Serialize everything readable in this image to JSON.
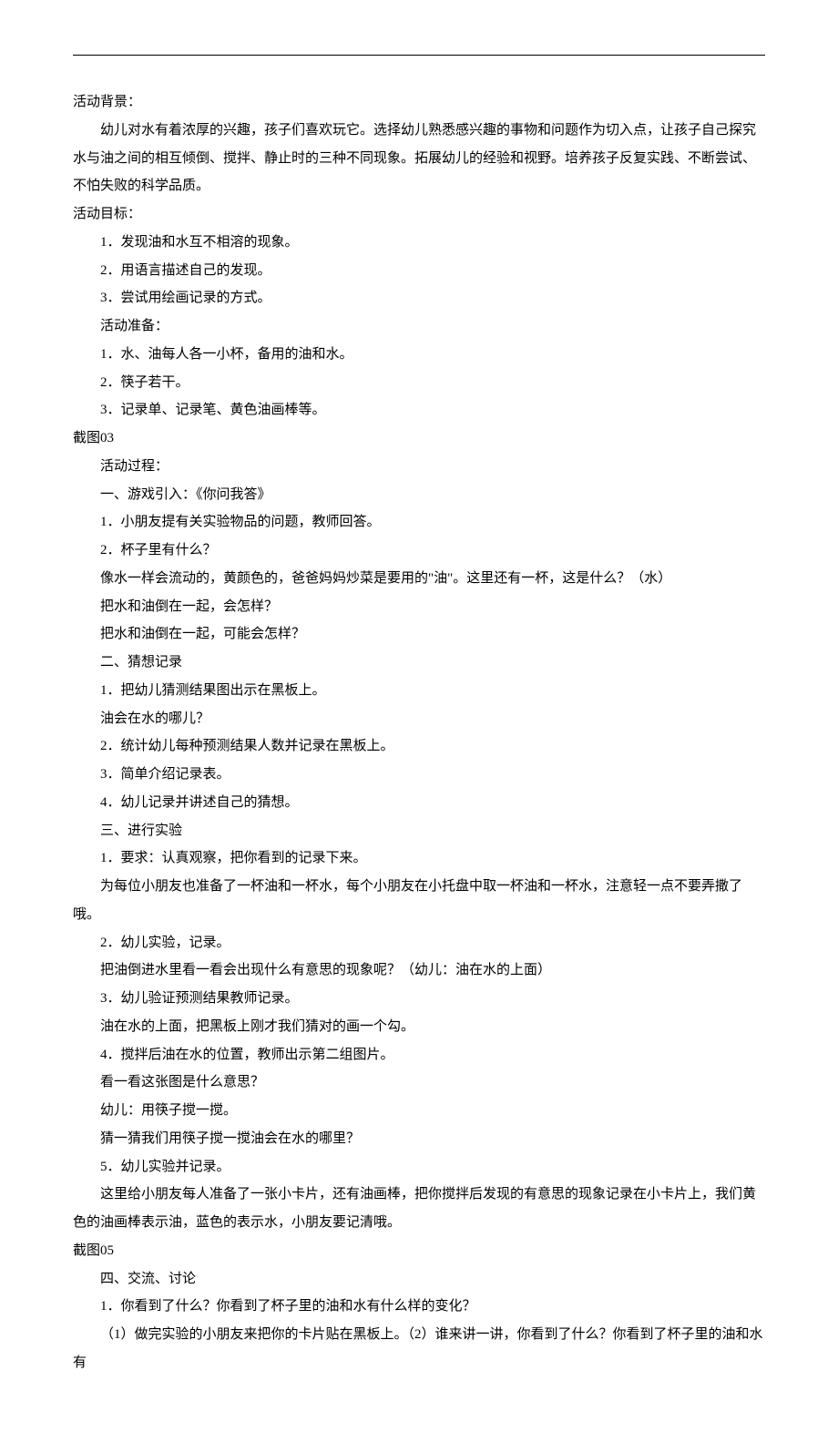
{
  "lines": [
    {
      "cls": "noindent",
      "text": "活动背景："
    },
    {
      "cls": "indent1",
      "text": "幼儿对水有着浓厚的兴趣，孩子们喜欢玩它。选择幼儿熟悉感兴趣的事物和问题作为切入点，让孩子自己探究水与油之间的相互倾倒、搅拌、静止时的三种不同现象。拓展幼儿的经验和视野。培养孩子反复实践、不断尝试、不怕失败的科学品质。"
    },
    {
      "cls": "noindent",
      "text": "活动目标："
    },
    {
      "cls": "indent1",
      "text": "1．发现油和水互不相溶的现象。"
    },
    {
      "cls": "indent1",
      "text": "2．用语言描述自己的发现。"
    },
    {
      "cls": "indent1",
      "text": "3．尝试用绘画记录的方式。"
    },
    {
      "cls": "indent1",
      "text": "活动准备："
    },
    {
      "cls": "indent1",
      "text": "1．水、油每人各一小杯，备用的油和水。"
    },
    {
      "cls": "indent1",
      "text": "2．筷子若干。"
    },
    {
      "cls": "indent1",
      "text": "3．记录单、记录笔、黄色油画棒等。"
    },
    {
      "cls": "noindent",
      "text": "截图03"
    },
    {
      "cls": "indent1",
      "text": "活动过程："
    },
    {
      "cls": "indent1",
      "text": "一、游戏引入：《你问我答》"
    },
    {
      "cls": "indent1",
      "text": "1．小朋友提有关实验物品的问题，教师回答。"
    },
    {
      "cls": "indent1",
      "text": "2．杯子里有什么？"
    },
    {
      "cls": "indent1",
      "text": "像水一样会流动的，黄颜色的，爸爸妈妈炒菜是要用的\"油\"。这里还有一杯，这是什么？（水）"
    },
    {
      "cls": "indent1",
      "text": "把水和油倒在一起，会怎样？"
    },
    {
      "cls": "indent1",
      "text": "把水和油倒在一起，可能会怎样？"
    },
    {
      "cls": "indent1",
      "text": "二、猜想记录"
    },
    {
      "cls": "indent1",
      "text": "1．把幼儿猜测结果图出示在黑板上。"
    },
    {
      "cls": "indent1",
      "text": "油会在水的哪儿？"
    },
    {
      "cls": "indent1",
      "text": "2．统计幼儿每种预测结果人数并记录在黑板上。"
    },
    {
      "cls": "indent1",
      "text": "3．简单介绍记录表。"
    },
    {
      "cls": "indent1",
      "text": "4．幼儿记录并讲述自己的猜想。"
    },
    {
      "cls": "indent1",
      "text": "三、进行实验"
    },
    {
      "cls": "indent1",
      "text": "1．要求：认真观察，把你看到的记录下来。"
    },
    {
      "cls": "indent1",
      "text": "为每位小朋友也准备了一杯油和一杯水，每个小朋友在小托盘中取一杯油和一杯水，注意轻一点不要弄撒了哦。"
    },
    {
      "cls": "indent1",
      "text": "2．幼儿实验，记录。"
    },
    {
      "cls": "indent1",
      "text": "把油倒进水里看一看会出现什么有意思的现象呢？（幼儿：油在水的上面）"
    },
    {
      "cls": "indent1",
      "text": "3．幼儿验证预测结果教师记录。"
    },
    {
      "cls": "indent1",
      "text": "油在水的上面，把黑板上刚才我们猜对的画一个勾。"
    },
    {
      "cls": "indent1",
      "text": "4．搅拌后油在水的位置，教师出示第二组图片。"
    },
    {
      "cls": "indent1",
      "text": "看一看这张图是什么意思？"
    },
    {
      "cls": "indent1",
      "text": "幼儿：用筷子搅一搅。"
    },
    {
      "cls": "indent1",
      "text": "猜一猜我们用筷子搅一搅油会在水的哪里？"
    },
    {
      "cls": "indent1",
      "text": "5．幼儿实验并记录。"
    },
    {
      "cls": "indent1",
      "text": "这里给小朋友每人准备了一张小卡片，还有油画棒，把你搅拌后发现的有意思的现象记录在小卡片上，我们黄色的油画棒表示油，蓝色的表示水，小朋友要记清哦。"
    },
    {
      "cls": "noindent",
      "text": "截图05"
    },
    {
      "cls": "indent1",
      "text": "四、交流、讨论"
    },
    {
      "cls": "indent1",
      "text": "1．你看到了什么？你看到了杯子里的油和水有什么样的变化？"
    },
    {
      "cls": "indent1",
      "text": "（1）做完实验的小朋友来把你的卡片贴在黑板上。（2）谁来讲一讲，你看到了什么？你看到了杯子里的油和水有"
    }
  ]
}
